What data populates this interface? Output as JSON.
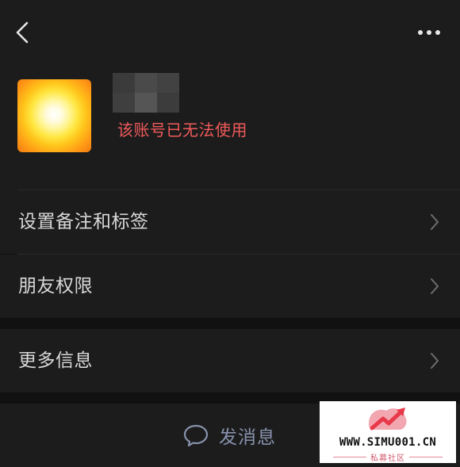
{
  "header": {
    "back_icon": "chevron-left-icon",
    "more_icon": "ellipsis-icon"
  },
  "profile": {
    "avatar_description": "yellow-orange glowing square",
    "name": "",
    "status_text": "该账号已无法使用",
    "status_color": "#f05a5a"
  },
  "menu": {
    "items": [
      {
        "label": "设置备注和标签",
        "icon": "chevron-right-icon"
      },
      {
        "label": "朋友权限",
        "icon": "chevron-right-icon"
      },
      {
        "label": "更多信息",
        "icon": "chevron-right-icon"
      }
    ]
  },
  "action": {
    "send_message_label": "发消息",
    "icon": "chat-bubble-icon",
    "color": "#8792ad"
  },
  "watermark": {
    "site": "WWW.SIMU001.CN",
    "subtitle": "私募社区",
    "brand_color": "#e8394a"
  }
}
